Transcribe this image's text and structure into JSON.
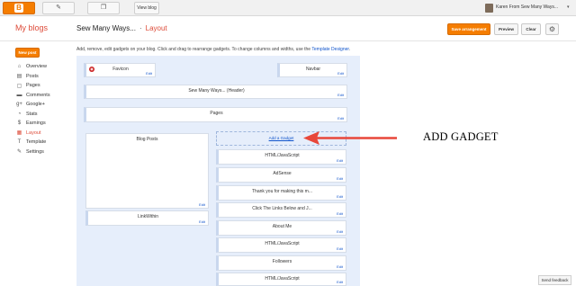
{
  "topbar": {
    "pencil_icon": "pencil-icon",
    "copy_icon": "copy-icon",
    "view_blog_label": "View blog",
    "user_name": "Karen From Sew Many Ways...",
    "caret": "▾"
  },
  "header": {
    "my_blogs": "My blogs",
    "blog_name": "Sew Many Ways...",
    "separator": "·",
    "section": "Layout",
    "save_label": "Save arrangement",
    "preview_label": "Preview",
    "clear_label": "Clear",
    "gear_icon": "gear-icon"
  },
  "sidebar": {
    "new_post": "New post",
    "items": [
      {
        "label": "Overview",
        "icon": "⌂",
        "active": false
      },
      {
        "label": "Posts",
        "icon": "▤",
        "active": false
      },
      {
        "label": "Pages",
        "icon": "▢",
        "active": false
      },
      {
        "label": "Comments",
        "icon": "▬",
        "active": false
      },
      {
        "label": "Google+",
        "icon": "g+",
        "active": false
      },
      {
        "label": "Stats",
        "icon": "◔",
        "active": false
      },
      {
        "label": "Earnings",
        "icon": "$",
        "active": false
      },
      {
        "label": "Layout",
        "icon": "▦",
        "active": true
      },
      {
        "label": "Template",
        "icon": "T",
        "active": false
      },
      {
        "label": "Settings",
        "icon": "✎",
        "active": false
      }
    ]
  },
  "main": {
    "intro_text": "Add, remove, edit gadgets on your blog. Click and drag to rearrange gadgets. To change columns and widths, use the ",
    "intro_link": "Template Designer",
    "intro_end": ".",
    "edit_label": "Edit",
    "gadgets": {
      "favicon": "Favicon",
      "navbar": "Navbar",
      "header": "Sew Many Ways... (Header)",
      "pages": "Pages",
      "blog_posts": "Blog Posts",
      "linkwithin": "LinkWithin",
      "add_gadget": "Add a Gadget",
      "sidebar_list": [
        "HTML/JavaScript",
        "AdSense",
        "Thank you for making this m...",
        "Click The Links Below and J...",
        "About Me",
        "HTML/JavaScript",
        "Followers",
        "HTML/JavaScript"
      ]
    }
  },
  "annotation": {
    "text": "ADD GADGET",
    "color": "#e8473a"
  },
  "footer": {
    "send_feedback": "Send feedback"
  },
  "colors": {
    "accent_orange": "#f57d00",
    "link_blue": "#1155cc",
    "active_red": "#dd4b39",
    "layout_bg": "#e6eefb"
  }
}
